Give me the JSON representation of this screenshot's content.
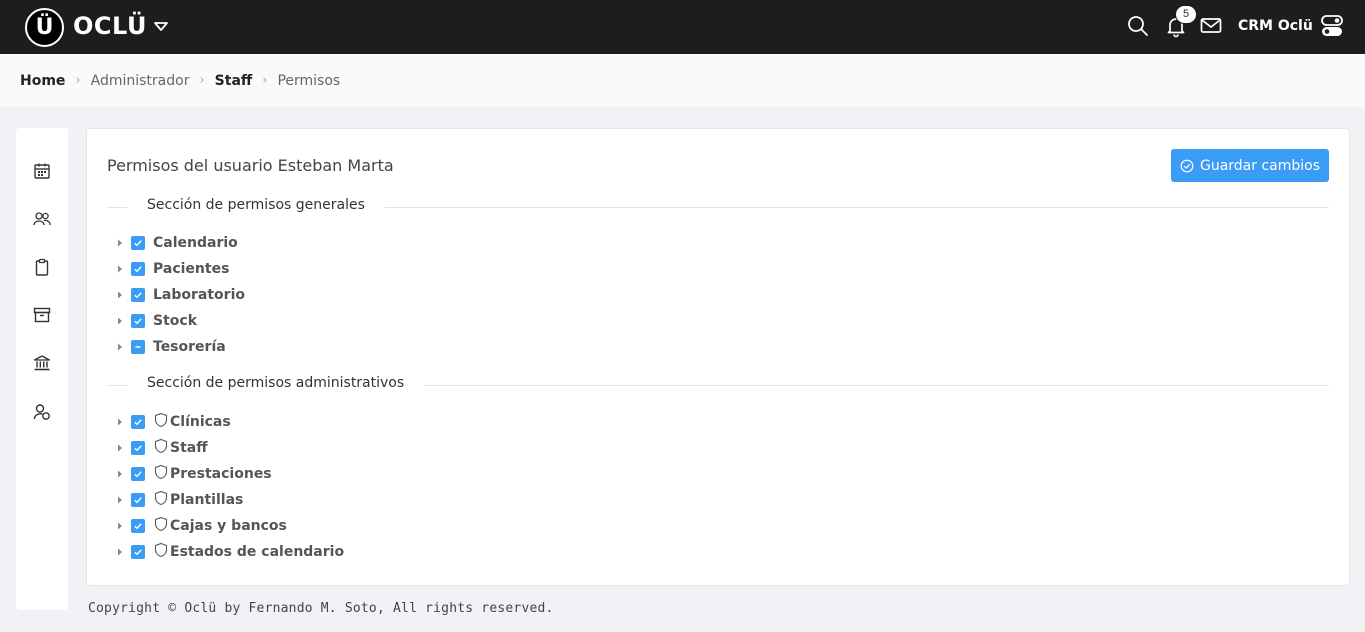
{
  "app": {
    "logo_letter": "Ü",
    "logo_text": "OCLÜ",
    "notification_count": "5",
    "user_name": "CRM Oclü"
  },
  "breadcrumb": [
    {
      "label": "Home",
      "strong": true
    },
    {
      "label": "Administrador",
      "strong": false
    },
    {
      "label": "Staff",
      "strong": true
    },
    {
      "label": "Permisos",
      "strong": false
    }
  ],
  "sidebar": {
    "icons": [
      "calendar-icon",
      "users-icon",
      "clipboard-icon",
      "archive-icon",
      "bank-icon",
      "user-settings-icon"
    ]
  },
  "card": {
    "title": "Permisos del usuario Esteban Marta",
    "save_label": "Guardar cambios"
  },
  "general_section": {
    "title": "Sección de permisos generales",
    "items": [
      {
        "label": "Calendario",
        "state": "checked"
      },
      {
        "label": "Pacientes",
        "state": "checked"
      },
      {
        "label": "Laboratorio",
        "state": "checked"
      },
      {
        "label": "Stock",
        "state": "checked"
      },
      {
        "label": "Tesorería",
        "state": "indeterminate"
      }
    ]
  },
  "admin_section": {
    "title": "Sección de permisos administrativos",
    "items": [
      {
        "label": "Clínicas",
        "state": "checked"
      },
      {
        "label": "Staff",
        "state": "checked"
      },
      {
        "label": "Prestaciones",
        "state": "checked"
      },
      {
        "label": "Plantillas",
        "state": "checked"
      },
      {
        "label": "Cajas y bancos",
        "state": "checked"
      },
      {
        "label": "Estados de calendario",
        "state": "checked"
      }
    ]
  },
  "footer": {
    "text": "Copyright © Oclü by Fernando M. Soto, All rights reserved."
  },
  "colors": {
    "topbar": "#1d1d1f",
    "accent": "#3a9cf5"
  }
}
